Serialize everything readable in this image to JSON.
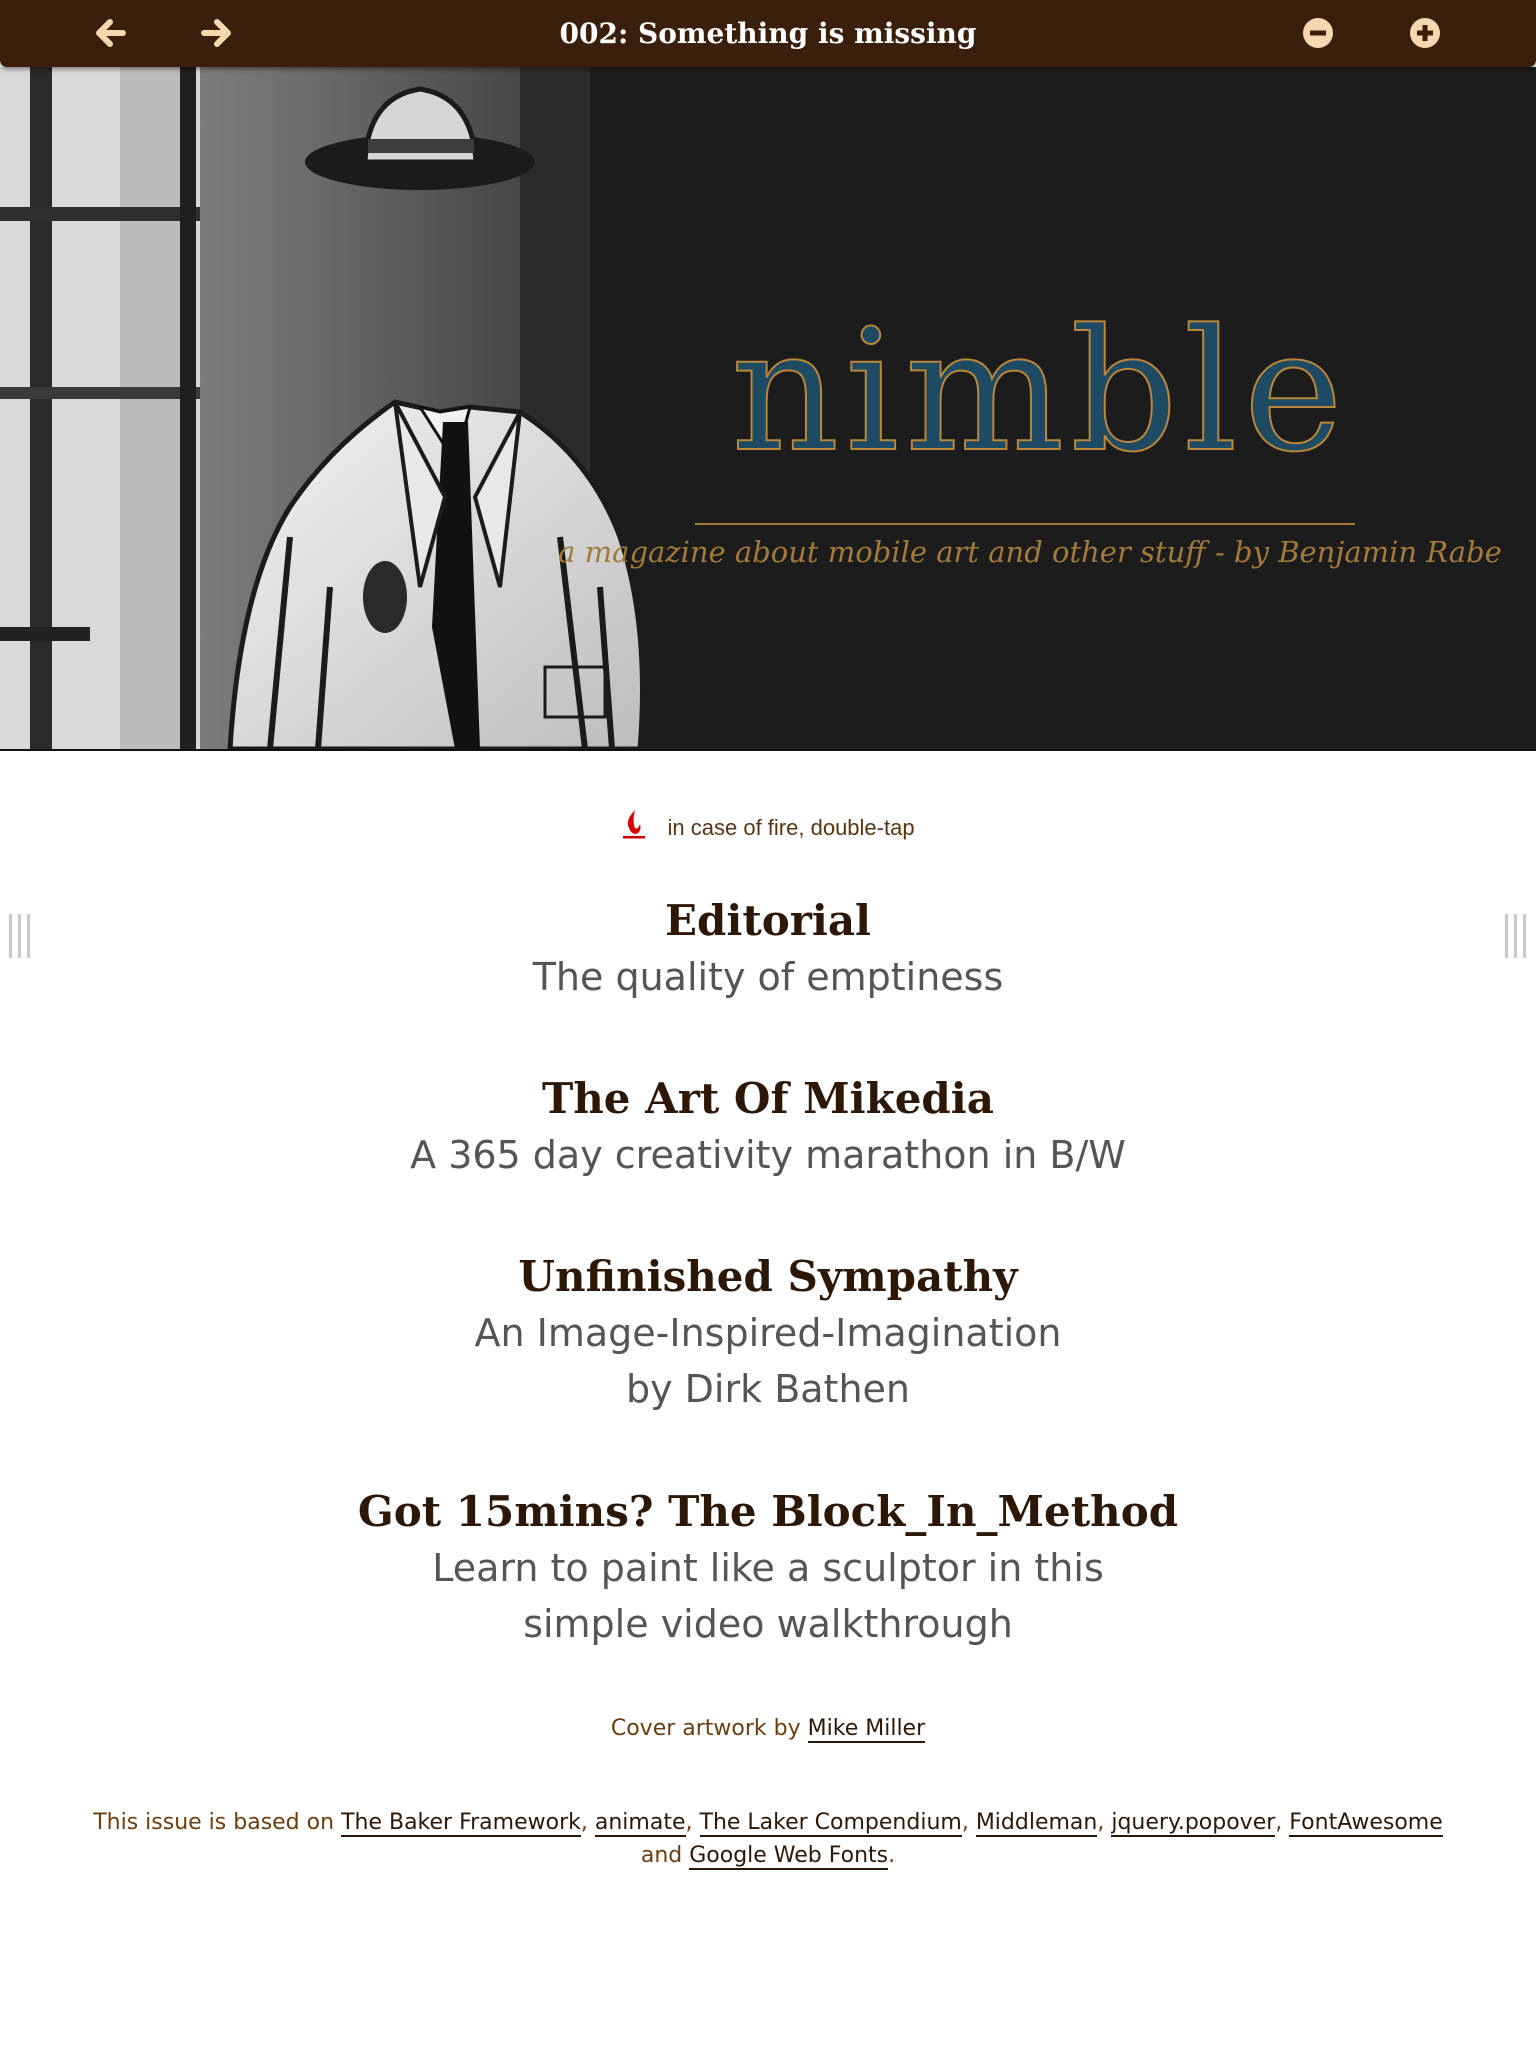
{
  "toolbar": {
    "title": "002: Something is missing",
    "back_icon": "arrow-left-icon",
    "forward_icon": "arrow-right-icon",
    "zoom_out_icon": "minus-circle-icon",
    "zoom_in_icon": "plus-circle-icon",
    "background_color": "#3a1f0c",
    "icon_color": "#f5d8b0"
  },
  "cover": {
    "logo": "nimble",
    "tagline": "a magazine about mobile art and other stuff - by Benjamin Rabe"
  },
  "hint": {
    "icon": "flame-icon",
    "text": "in case of fire, double-tap",
    "icon_color": "#d40000"
  },
  "toc": [
    {
      "title": "Editorial",
      "subtitle": "The quality of emptiness"
    },
    {
      "title": "The Art Of Mikedia",
      "subtitle": "A 365 day creativity marathon in B/W"
    },
    {
      "title": "Unfinished Sympathy",
      "subtitle": "An Image-Inspired-Imagination\nby Dirk Bathen"
    },
    {
      "title": "Got 15mins? The Block_In_Method",
      "subtitle": "Learn to paint like a sculptor in this\nsimple video walkthrough"
    }
  ],
  "credit": {
    "prefix": "Cover artwork by",
    "artist": "Mike Miller"
  },
  "footer": {
    "prefix": "This issue is based on",
    "links": [
      "The Baker Framework",
      "animate",
      "The Laker Compendium",
      "Middleman",
      "jquery.popover",
      "FontAwesome"
    ],
    "and": "and",
    "last_link": "Google Web Fonts",
    "end": "."
  },
  "colors": {
    "heading": "#2d1808",
    "subtitle": "#555555",
    "credit_text": "#6b3d10"
  }
}
